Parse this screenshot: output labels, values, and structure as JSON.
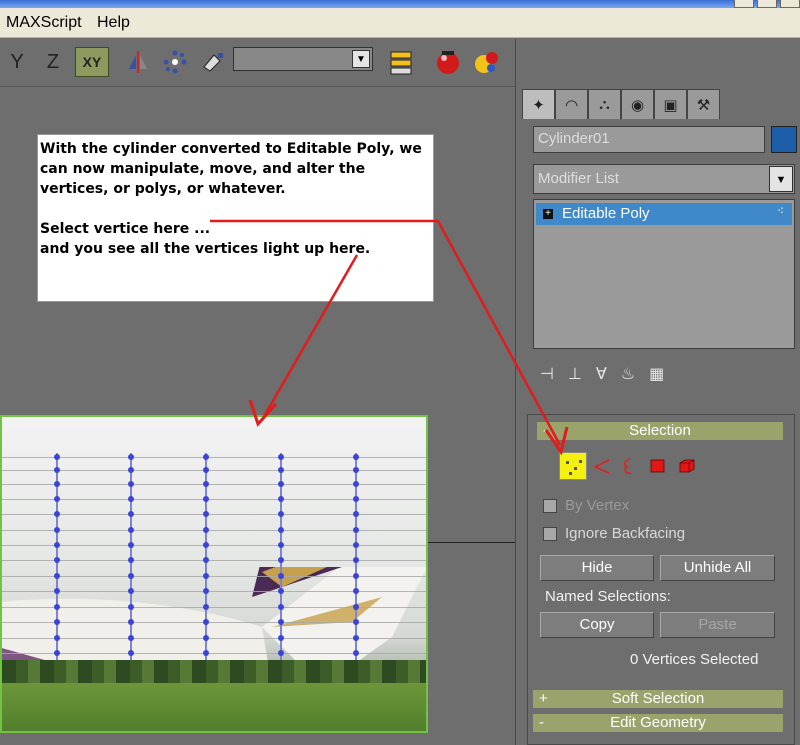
{
  "menu": {
    "maxscript_label": "MAXScript",
    "help_label": "Help"
  },
  "toolbar": {
    "y_label": "Y",
    "z_label": "Z",
    "xy_label": "XY",
    "selection_set_value": ""
  },
  "note": {
    "paragraph1": "With the cylinder converted to Editable Poly, we\ncan now manipulate, move, and alter the\nvertices, or polys, or whatever.",
    "paragraph2": "Select vertice here ...\nand you see all the vertices light up here."
  },
  "panel": {
    "object_name": "Cylinder01",
    "modifier_list": "Modifier List",
    "stack_item": "Editable Poly",
    "stack_item_sign": "+",
    "object_color": "#1c5ea8",
    "selection": {
      "title": "Selection",
      "collapse_sign": "-",
      "by_vertex_label": "By Vertex",
      "ignore_backfacing_label": "Ignore Backfacing",
      "hide_label": "Hide",
      "unhide_all_label": "Unhide All",
      "named_selections_label": "Named Selections:",
      "copy_label": "Copy",
      "paste_label": "Paste",
      "status": "0 Vertices Selected"
    },
    "soft_selection": {
      "title": "Soft Selection",
      "sign": "+"
    },
    "edit_geometry": {
      "title": "Edit Geometry",
      "sign": "-"
    }
  },
  "colors": {
    "annotation_arrow": "#e21b1b",
    "vertex_dot": "#3b44d6",
    "active_level": "#f6f010"
  }
}
